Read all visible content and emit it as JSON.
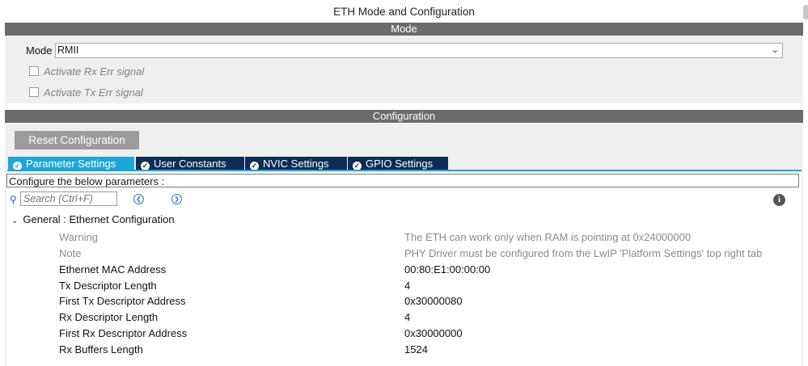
{
  "window": {
    "title": "ETH Mode and Configuration"
  },
  "mode_section": {
    "header": "Mode",
    "mode_label": "Mode",
    "mode_value": "RMII",
    "checkboxes": [
      {
        "label": "Activate Rx Err signal",
        "checked": false
      },
      {
        "label": "Activate Tx Err signal",
        "checked": false
      }
    ]
  },
  "config_section": {
    "header": "Configuration",
    "reset_button": "Reset Configuration",
    "tabs": [
      {
        "label": "Parameter Settings",
        "active": true
      },
      {
        "label": "User Constants",
        "active": false
      },
      {
        "label": "NVIC Settings",
        "active": false
      },
      {
        "label": "GPIO Settings",
        "active": false
      }
    ],
    "caption": "Configure the below parameters :",
    "search_placeholder": "Search (Ctrl+F)",
    "group_title": "General : Ethernet Configuration",
    "params": [
      {
        "name": "Warning",
        "value": "The ETH can work only when RAM is pointing at 0x24000000"
      },
      {
        "name": "Note",
        "value": "PHY Driver must be configured from the LwIP 'Platform Settings' top right tab"
      },
      {
        "name": "Ethernet MAC Address",
        "value": "00:80:E1:00:00:00"
      },
      {
        "name": "Tx Descriptor Length",
        "value": "4"
      },
      {
        "name": "First Tx Descriptor Address",
        "value": "0x30000080"
      },
      {
        "name": "Rx Descriptor Length",
        "value": "4"
      },
      {
        "name": "First Rx Descriptor Address",
        "value": "0x30000000"
      },
      {
        "name": "Rx Buffers Length",
        "value": "1524"
      }
    ]
  },
  "colors": {
    "active_tab": "#1da6d8",
    "inactive_tab": "#0c2d57",
    "section_bar": "#6b6b6b"
  },
  "icons": {
    "tab_icon": "check-circle-icon",
    "search": "search-icon",
    "prev": "chevron-left-icon",
    "next": "chevron-right-icon",
    "info": "info-icon",
    "expand": "chevron-down-icon"
  }
}
